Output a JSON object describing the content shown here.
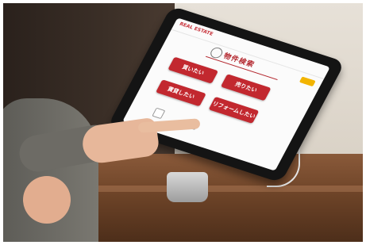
{
  "screen": {
    "brand_text": "REAL ESTATE",
    "title": "物件検索",
    "buttons": [
      {
        "label": "買いたい"
      },
      {
        "label": "売りたい"
      },
      {
        "label": "賃貸したい"
      },
      {
        "label": "リフォームしたい"
      }
    ]
  },
  "colors": {
    "accent_red": "#c2282f",
    "accent_yellow": "#f2b400"
  }
}
